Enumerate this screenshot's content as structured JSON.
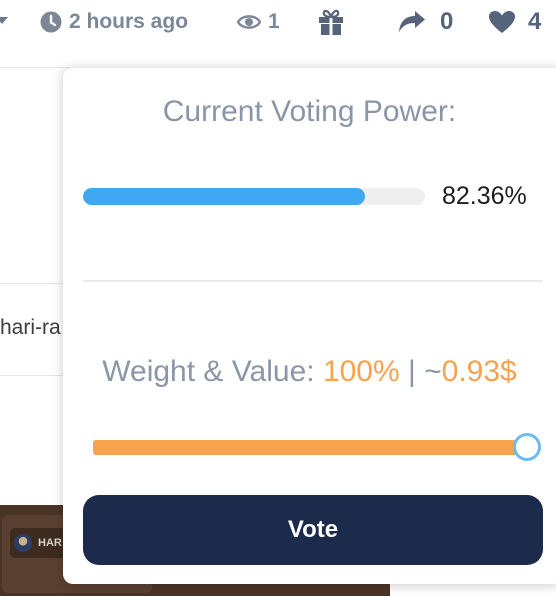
{
  "stats": {
    "time_ago": "2 hours ago",
    "views": "1",
    "shares": "0",
    "likes": "4"
  },
  "background": {
    "author_fragment": "hari-ra",
    "image_chip_text": "HAR"
  },
  "voting": {
    "title": "Current Voting Power:",
    "power_percent_text": "82.36%",
    "power_fraction": 0.8236,
    "weight_label": "Weight & Value: ",
    "weight_value": "100%",
    "separator": " | ~",
    "vote_value": "0.93$",
    "weight_fraction": 1.0,
    "vote_button_label": "Vote"
  },
  "colors": {
    "accent_orange": "#f8a24c",
    "power_blue": "#3fa8f3",
    "vote_button_bg": "#1c2a4b",
    "muted_text": "#8a96a8"
  },
  "icons": {
    "time": "clock-icon",
    "views": "eye-icon",
    "gift": "gift-icon",
    "shares": "share-icon",
    "likes": "heart-icon",
    "dropdown": "caret-down-icon"
  }
}
